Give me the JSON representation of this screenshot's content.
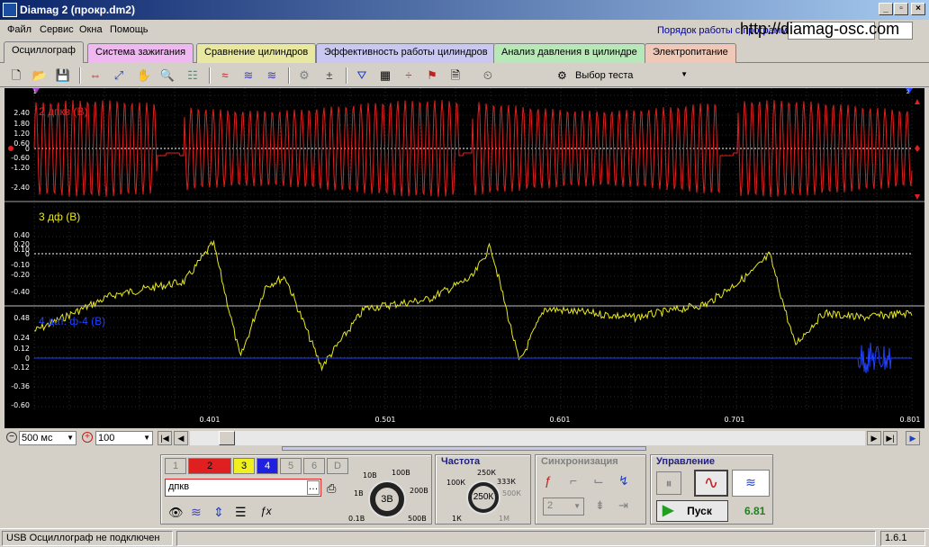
{
  "window": {
    "title": "Diamag 2 (прокр.dm2)",
    "btn_min": "_",
    "btn_max": "▫",
    "btn_close": "×"
  },
  "menu": [
    "Файл",
    "Сервис",
    "Окна",
    "Помощь"
  ],
  "menu_link": "Порядок работы с программой",
  "site_url": "http://diamag-osc.com",
  "tabs": [
    "Осциллограф",
    "Система зажигания",
    "Сравнение цилиндров",
    "Эффективность работы цилиндров",
    "Анализ давления в цилиндре",
    "Электропитание"
  ],
  "tab_colors": [
    "#d4d0c8",
    "#f0b8f0",
    "#e8e8a0",
    "#c8c8f0",
    "#b8e8b8",
    "#f0c8b8"
  ],
  "toolbar": {
    "test_select": "Выбор теста"
  },
  "plot": {
    "ch2_label": "2 дпкв (В)",
    "ch3_label": "3  дф (В)",
    "ch4_label": "4  дат. ф-4 (В)",
    "ch2_ticks": [
      "2.40",
      "1.80",
      "1.20",
      "0.60",
      "0",
      "-0.60",
      "-1.20",
      "-2.40"
    ],
    "ch3_ticks": [
      "0.40",
      "0.20",
      "0.10",
      "0",
      "-0.10",
      "-0.20",
      "-0.40"
    ],
    "ch4_ticks": [
      "0.48",
      "0.24",
      "0.12",
      "0",
      "-0.12",
      "-0.36",
      "-0.60"
    ],
    "x_ticks": [
      "0.401",
      "0.501",
      "0.601",
      "0.701",
      "0.801"
    ],
    "marker_left": "1",
    "marker_right": "2"
  },
  "chart_data": {
    "type": "line",
    "x_ticks": [
      0.401,
      0.501,
      0.601,
      0.701,
      0.801
    ],
    "series": [
      {
        "name": "2 дпкв (В)",
        "color": "#e02020",
        "values_description": ""
      },
      {
        "name": "3  дф (В)",
        "color": "#e8e820"
      },
      {
        "name": "4  дат. ф-4 (В)",
        "color": "#2040ff"
      }
    ]
  },
  "scroll": {
    "timebase": "500 мс",
    "zoom": "100"
  },
  "channels": {
    "buttons": [
      "1",
      "2",
      "3",
      "4",
      "5",
      "6",
      "D"
    ],
    "name": "дпкв",
    "scale_labels": [
      "10В",
      "100В",
      "200В",
      "500В",
      "0.1В",
      "1В"
    ],
    "scale_value": "3В"
  },
  "freq": {
    "title": "Частота",
    "labels": [
      "100К",
      "250К",
      "333К",
      "500К",
      "1М",
      "1К"
    ],
    "value": "250К"
  },
  "sync": {
    "title": "Синхронизация",
    "channel": "2"
  },
  "control": {
    "title": "Управление",
    "start_label": "Пуск",
    "value": "6.81"
  },
  "status": {
    "text": "USB Осциллограф не подключен",
    "version": "1.6.1"
  }
}
